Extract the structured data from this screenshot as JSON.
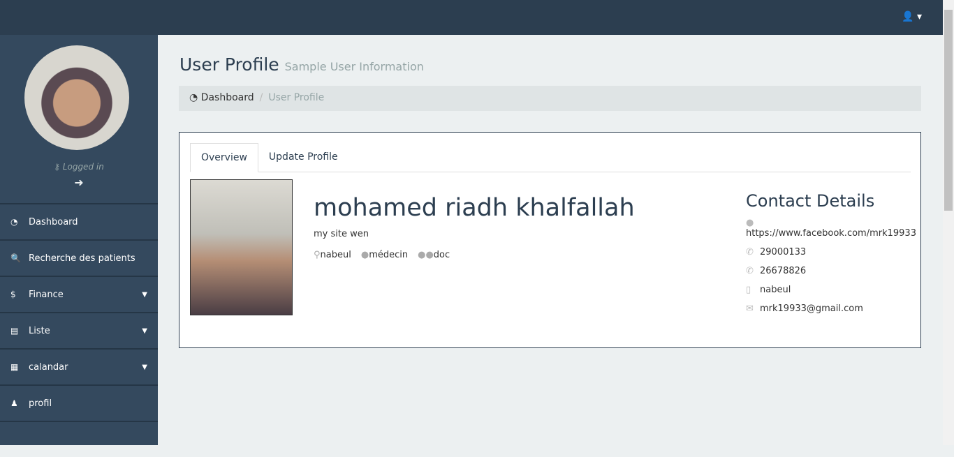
{
  "topbar": {
    "user_icon": "user-icon"
  },
  "sidebar": {
    "logged_in": "Logged in",
    "items": [
      {
        "label": "Dashboard",
        "icon": "dashboard-icon",
        "g": "◔"
      },
      {
        "label": "Recherche des patients",
        "icon": "search-icon",
        "g": "🔍"
      },
      {
        "label": "Finance",
        "icon": "dollar-icon",
        "g": "$",
        "caret": true
      },
      {
        "label": "Liste",
        "icon": "list-icon",
        "g": "▤",
        "caret": true
      },
      {
        "label": "calandar",
        "icon": "calendar-icon",
        "g": "▦",
        "caret": true
      },
      {
        "label": "profil",
        "icon": "person-icon",
        "g": "♟"
      }
    ]
  },
  "header": {
    "title": "User Profile",
    "subtitle": "Sample User Information"
  },
  "breadcrumb": {
    "home": "Dashboard",
    "current": "User Profile"
  },
  "tabs": [
    "Overview",
    "Update Profile"
  ],
  "profile": {
    "name": "mohamed riadh khalfallah",
    "site": "my site wen",
    "location": "nabeul",
    "role": "médecin",
    "group": "doc"
  },
  "contact": {
    "title": "Contact Details",
    "website": "https://www.facebook.com/mrk19933",
    "phone1": "29000133",
    "phone2": "26678826",
    "address": "nabeul",
    "email": "mrk19933@gmail.com"
  }
}
